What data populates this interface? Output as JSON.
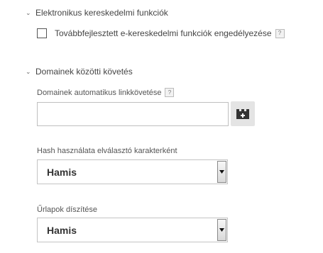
{
  "sections": {
    "ecommerce": {
      "title": "Elektronikus kereskedelmi funkciók",
      "checkbox_label": "Továbbfejlesztett e-kereskedelmi funkciók engedélyezése",
      "checkbox_checked": false
    },
    "cross_domain": {
      "title": "Domainek közötti követés",
      "autolink_label": "Domainek automatikus linkkövetése",
      "autolink_value": "",
      "variable_button_icon": "variable-brick-icon",
      "hash_label": "Hash használata elválasztó karakterként",
      "hash_value": "Hamis",
      "forms_label": "Űrlapok díszítése",
      "forms_value": "Hamis"
    }
  },
  "help_glyph": "?",
  "collapse_glyph": "⌄"
}
